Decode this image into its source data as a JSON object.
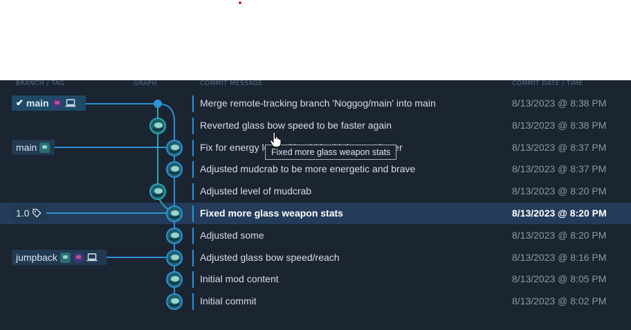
{
  "headers": {
    "branch_tag": "BRANCH / TAG",
    "graph": "GRAPH",
    "commit_message": "COMMIT MESSAGE",
    "commit_date": "COMMIT DATE / TIME"
  },
  "refs": {
    "main_head": {
      "label": "main",
      "icons": [
        "check-icon",
        "avatar-icon",
        "laptop-icon"
      ]
    },
    "main_remote": {
      "label": "main",
      "icons": [
        "avatar-icon"
      ]
    },
    "tag": {
      "label": "1.0",
      "icons": [
        "tag-icon"
      ]
    },
    "jumpback": {
      "label": "jumpback",
      "icons": [
        "avatar-icon",
        "avatar-icon",
        "laptop-icon"
      ]
    }
  },
  "commits": [
    {
      "message": "Merge remote-tracking branch 'Noggog/main' into main",
      "date": "8/13/2023 @ 8:38 PM"
    },
    {
      "message": "Reverted glass bow speed to be faster again",
      "date": "8/13/2023 @ 8:38 PM"
    },
    {
      "message": "Fix for energy level. Should be higher not lower",
      "date": "8/13/2023 @ 8:37 PM"
    },
    {
      "message": "Adjusted mudcrab to be more energetic and brave",
      "date": "8/13/2023 @ 8:37 PM"
    },
    {
      "message": "Adjusted level of mudcrab",
      "date": "8/13/2023 @ 8:20 PM"
    },
    {
      "message": "Fixed more glass weapon stats",
      "date": "8/13/2023 @ 8:20 PM",
      "selected": true
    },
    {
      "message": "Adjusted some",
      "date": "8/13/2023 @ 8:20 PM"
    },
    {
      "message": "Adjusted glass bow speed/reach",
      "date": "8/13/2023 @ 8:16 PM"
    },
    {
      "message": "Initial mod content",
      "date": "8/13/2023 @ 8:05 PM"
    },
    {
      "message": "Initial commit",
      "date": "8/13/2023 @ 8:02 PM"
    }
  ],
  "tooltip": "Fixed more glass weapon stats",
  "colors": {
    "panel_bg": "#1b2431",
    "selected_row": "#243c5a",
    "branch_line": "#2b94d7",
    "lane2": "#2aa7b4"
  }
}
